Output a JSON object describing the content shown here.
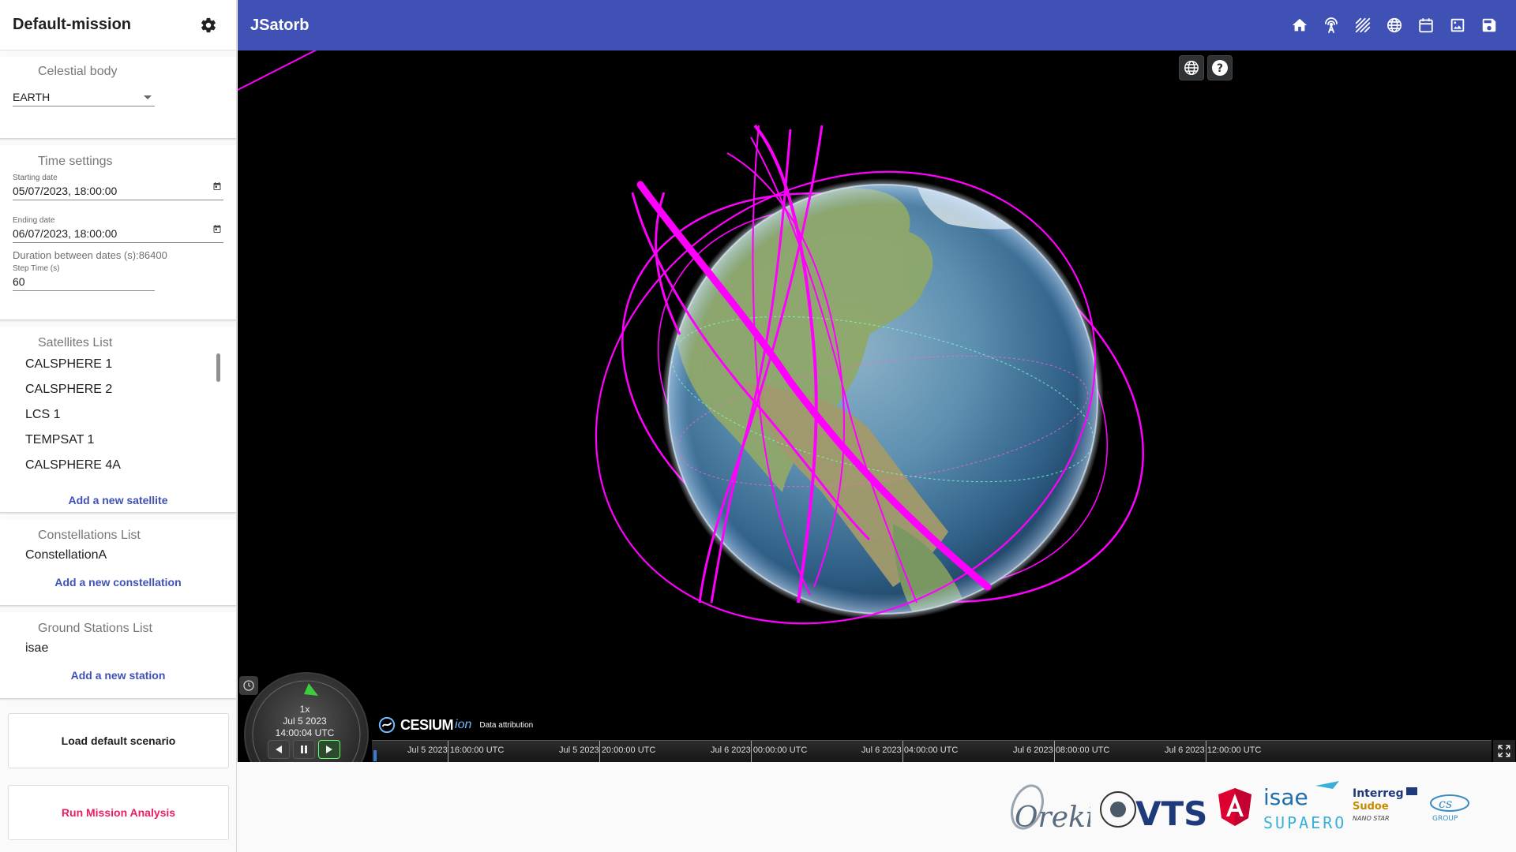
{
  "sidebar": {
    "mission_title": "Default-mission",
    "celestial": {
      "title": "Celestial body",
      "selected": "EARTH"
    },
    "time": {
      "title": "Time settings",
      "start_label": "Starting date",
      "start_value": "05/07/2023, 18:00:00",
      "end_label": "Ending date",
      "end_value": "06/07/2023, 18:00:00",
      "duration_text": "Duration between dates (s):86400",
      "step_label": "Step Time (s)",
      "step_value": "60"
    },
    "satellites": {
      "title": "Satellites List",
      "items": [
        "CALSPHERE 1",
        "CALSPHERE 2",
        "LCS 1",
        "TEMPSAT 1",
        "CALSPHERE 4A"
      ],
      "add_label": "Add a new satellite"
    },
    "constellations": {
      "title": "Constellations List",
      "items": [
        "ConstellationA"
      ],
      "add_label": "Add a new constellation"
    },
    "ground_stations": {
      "title": "Ground Stations List",
      "items": [
        "isae"
      ],
      "add_label": "Add a new station"
    },
    "load_button": "Load default scenario",
    "run_button": "Run Mission Analysis"
  },
  "topbar": {
    "title": "JSatorb",
    "icons": [
      "home-icon",
      "antenna-icon",
      "stripes-icon",
      "globe-icon",
      "calendar-icon",
      "image-icon",
      "save-icon"
    ]
  },
  "viewer": {
    "animation": {
      "speed": "1x",
      "date": "Jul 5 2023",
      "time": "14:00:04 UTC"
    },
    "credits": {
      "logo": "CESIUM",
      "ion": "ion",
      "attribution": "Data attribution"
    },
    "timeline": {
      "labels": [
        "Jul 5 2023 16:00:00 UTC",
        "Jul 5 2023 20:00:00 UTC",
        "Jul 6 2023 00:00:00 UTC",
        "Jul 6 2023 04:00:00 UTC",
        "Jul 6 2023 08:00:00 UTC",
        "Jul 6 2023 12:00:00 UTC"
      ]
    }
  },
  "footer": {
    "logos": {
      "orekit": "Orekit",
      "vts": "VTS",
      "isae_top": "isae",
      "isae_bottom": "SUPAERO",
      "interreg_1": "Interreg",
      "interreg_2": "Sudoe",
      "interreg_3": "NANO STAR",
      "cs_group": "GROUP"
    }
  },
  "colors": {
    "primary": "#3f51b5",
    "orbit": "#ff00ff",
    "run_button_text": "#e91e63",
    "link": "#3f51b5"
  }
}
